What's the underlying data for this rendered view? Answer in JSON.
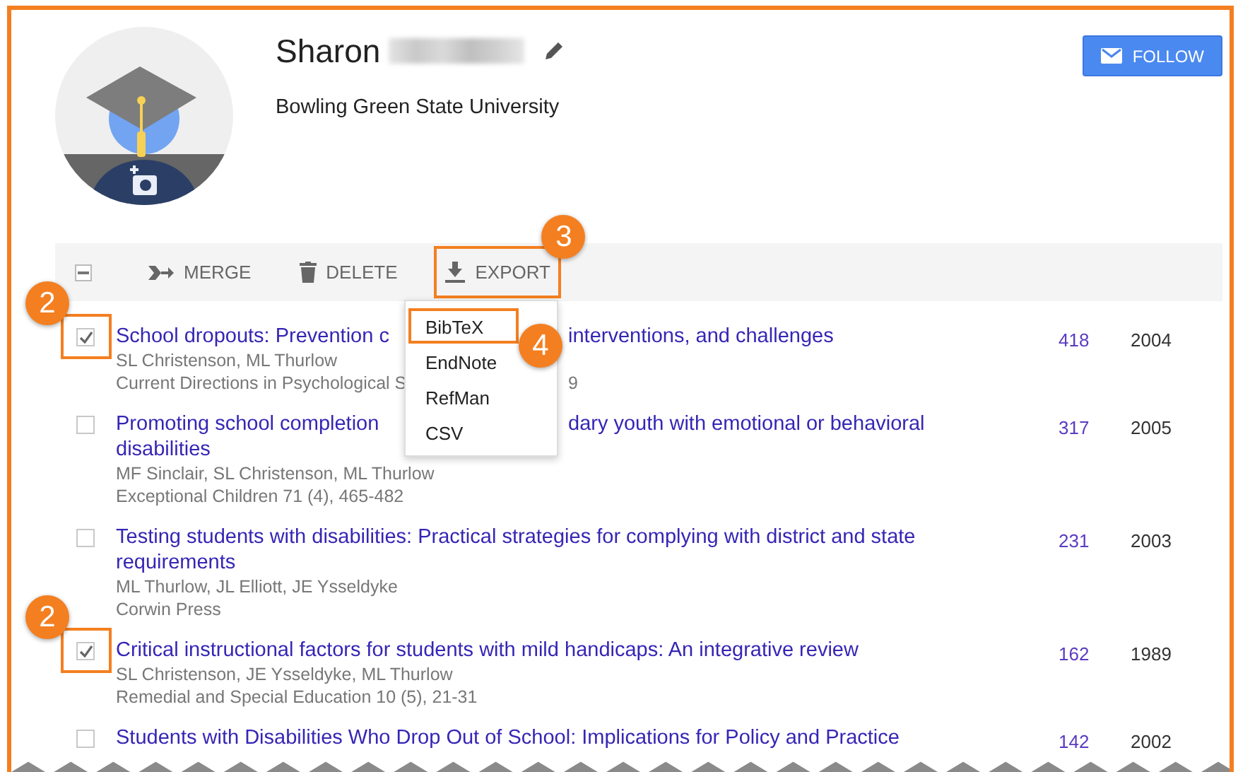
{
  "profile": {
    "name": "Sharon",
    "name_redacted": true,
    "affiliation": "Bowling Green State University",
    "follow_label": "FOLLOW"
  },
  "toolbar": {
    "select_all_indeterminate": true,
    "actions": [
      {
        "kind": "merge",
        "label": "MERGE"
      },
      {
        "kind": "delete",
        "label": "DELETE"
      },
      {
        "kind": "export",
        "label": "EXPORT",
        "callout": "3"
      }
    ]
  },
  "export_menu": {
    "items": [
      {
        "label": "BibTeX",
        "callout": "4"
      },
      {
        "label": "EndNote"
      },
      {
        "label": "RefMan"
      },
      {
        "label": "CSV"
      }
    ]
  },
  "rows": [
    {
      "checked": true,
      "callout": "2",
      "title_lines": [
        [
          "School dropouts: Prevention c",
          "interventions, and challenges"
        ]
      ],
      "authors": "SL Christenson, ML Thurlow",
      "venue": [
        "Current Directions in Psychological S",
        "9"
      ],
      "cited_by": "418",
      "year": "2004"
    },
    {
      "checked": false,
      "title_lines": [
        [
          "Promoting school completion",
          "dary youth with emotional or behavioral"
        ],
        [
          "disabilities"
        ]
      ],
      "authors": "MF Sinclair, SL Christenson, ML Thurlow",
      "venue": [
        "Exceptional Children 71 (4), 465-482"
      ],
      "cited_by": "317",
      "year": "2005"
    },
    {
      "checked": false,
      "title_lines": [
        [
          "Testing students with disabilities: Practical strategies for complying with district and state"
        ],
        [
          "requirements"
        ]
      ],
      "authors": "ML Thurlow, JL Elliott, JE Ysseldyke",
      "venue": [
        "Corwin Press"
      ],
      "cited_by": "231",
      "year": "2003"
    },
    {
      "checked": true,
      "callout": "2",
      "title_lines": [
        [
          "Critical instructional factors for students with mild handicaps: An integrative review"
        ]
      ],
      "authors": "SL Christenson, JE Ysseldyke, ML Thurlow",
      "venue": [
        "Remedial and Special Education 10 (5), 21-31"
      ],
      "cited_by": "162",
      "year": "1989"
    },
    {
      "checked": false,
      "title_lines": [
        [
          "Students with Disabilities Who Drop Out of School: Implications for Policy and Practice"
        ]
      ],
      "cited_by": "142",
      "year": "2002"
    }
  ]
}
